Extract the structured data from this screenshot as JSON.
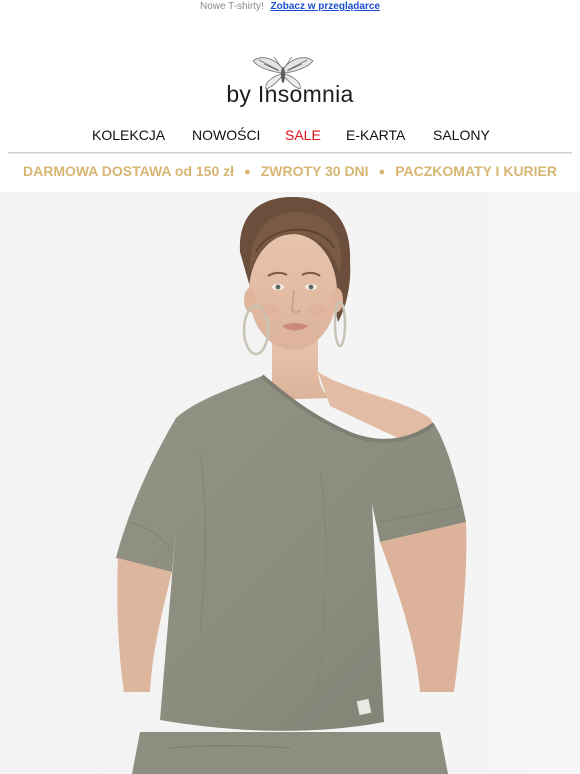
{
  "preheader": {
    "text": "Nowe T-shirty!",
    "browser_link": "Zobacz w przeglądarce"
  },
  "logo": {
    "brand": "by Insomnia",
    "icon": "moth-icon"
  },
  "nav": {
    "items": [
      {
        "label": "KOLEKCJA"
      },
      {
        "label": "NOWOŚCI"
      },
      {
        "label": "SALE",
        "color": "#e0121a"
      },
      {
        "label": "E-KARTA"
      },
      {
        "label": "SALONY"
      }
    ]
  },
  "benefits": {
    "items": [
      "DARMOWA DOSTAWA od 150 zł",
      "ZWROTY 30 DNI",
      "PACZKOMATY I KURIER"
    ],
    "separator": "●",
    "color": "#d6b672"
  },
  "hero": {
    "background": "#f3f3f3",
    "shirt_color": "#8d8e80"
  }
}
